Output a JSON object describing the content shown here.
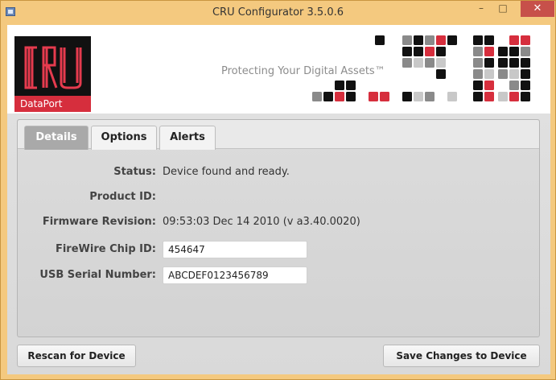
{
  "window": {
    "title": "CRU Configurator 3.5.0.6",
    "controls": {
      "minimize": "–",
      "maximize": "□",
      "close": "✕"
    }
  },
  "banner": {
    "logo_text": "CRU",
    "logo_subtext": "DataPort",
    "tagline": "Protecting Your Digital Assets™",
    "colors": {
      "red": "#d62e3d",
      "black": "#111111",
      "gray": "#8a8a8a",
      "light": "#c8c8c8"
    }
  },
  "tabs": [
    {
      "label": "Details",
      "active": true
    },
    {
      "label": "Options",
      "active": false
    },
    {
      "label": "Alerts",
      "active": false
    }
  ],
  "details": {
    "status": {
      "label": "Status:",
      "value": "Device found and ready."
    },
    "product_id": {
      "label": "Product ID:",
      "value": ""
    },
    "firmware": {
      "label": "Firmware Revision:",
      "value": "09:53:03 Dec 14 2010 (v a3.40.0020)"
    },
    "firewire_chip_id": {
      "label": "FireWire Chip ID:",
      "value": "454647"
    },
    "usb_serial": {
      "label": "USB Serial Number:",
      "value": "ABCDEF0123456789"
    }
  },
  "buttons": {
    "rescan": "Rescan for Device",
    "save": "Save Changes to Device"
  }
}
